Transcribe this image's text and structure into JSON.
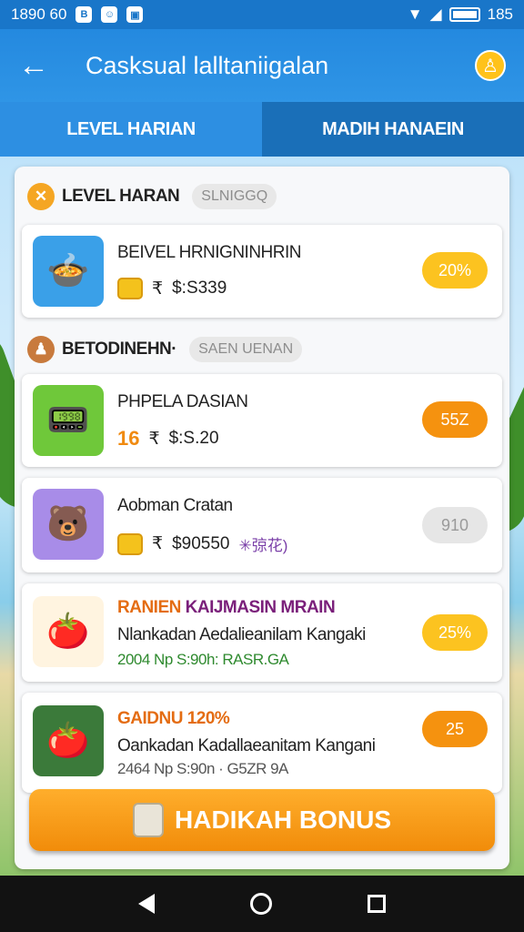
{
  "statusbar": {
    "time": "1890 60",
    "battery_text": "185"
  },
  "appbar": {
    "title": "Casksual lalltaniigalan"
  },
  "tabs": [
    {
      "label": "LEVEL HARIAN"
    },
    {
      "label": "MADIH HANAEIN"
    }
  ],
  "sections": [
    {
      "title": "LEVEL HARAN",
      "pill": "SLNIGGQ"
    },
    {
      "title": "BETODINEHN·",
      "pill": "SAEN UENAN"
    }
  ],
  "cards": [
    {
      "title": "BEIVEL HRNIGNINHRIN",
      "amount": "$:S339",
      "currency": "₹",
      "badge": "20%"
    },
    {
      "title": "PHPELA DASIAN",
      "prefix": "16",
      "amount": "$:S.20",
      "currency": "₹",
      "badge": "55Z"
    },
    {
      "title": "Aobman Cratan",
      "amount": "$90550",
      "currency": "₹",
      "extra": "✳弶花)",
      "badge": "910"
    },
    {
      "title_a": "RANIEN",
      "title_b": "KAIJMASIN MRAIN",
      "line2": "Nlankadan Aedalieanilam Kangaki",
      "line3": "2004 Np S:90h: RASR.GA",
      "badge": "25%"
    },
    {
      "title_a": "GAIDNU 120%",
      "line2": "Oankadan Kadallaeanitam Kangani",
      "line3": "2464 Np S:90n · G5ZR 9A",
      "badge": "25"
    }
  ],
  "bonus_button": {
    "label": "HADIKAH BONUS"
  },
  "colors": {
    "primary": "#2489df",
    "accent_orange": "#f5920f",
    "accent_yellow": "#ffc21a"
  }
}
